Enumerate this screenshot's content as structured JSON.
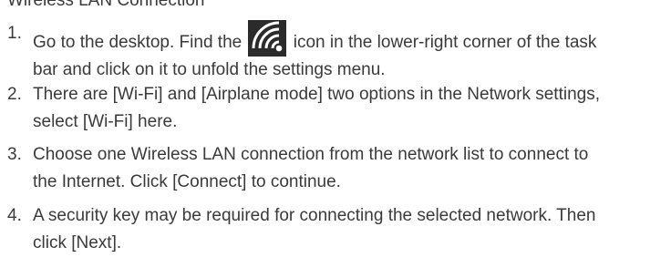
{
  "heading": "Wireless LAN Connection",
  "steps": [
    {
      "number": "1.",
      "line1_before": "Go to the desktop. Find the",
      "line1_after": "icon in the lower-right corner of the task",
      "line2": "bar and click on it to unfold the settings menu."
    },
    {
      "number": "2.",
      "line1": "There are [Wi-Fi] and [Airplane mode] two options in the Network settings,",
      "line2": "select [Wi-Fi] here."
    },
    {
      "number": "3.",
      "line1": "Choose one Wireless LAN connection from the network list to connect to",
      "line2": "the Internet. Click [Connect] to continue."
    },
    {
      "number": "4.",
      "line1": "A security key may be required for connecting the selected network. Then",
      "line2": "click [Next]."
    }
  ],
  "colors": {
    "text": "#3a3a3a",
    "icon_bg": "#2b2b2b",
    "icon_fg": "#ffffff"
  },
  "icons": {
    "network": "wifi-icon"
  }
}
